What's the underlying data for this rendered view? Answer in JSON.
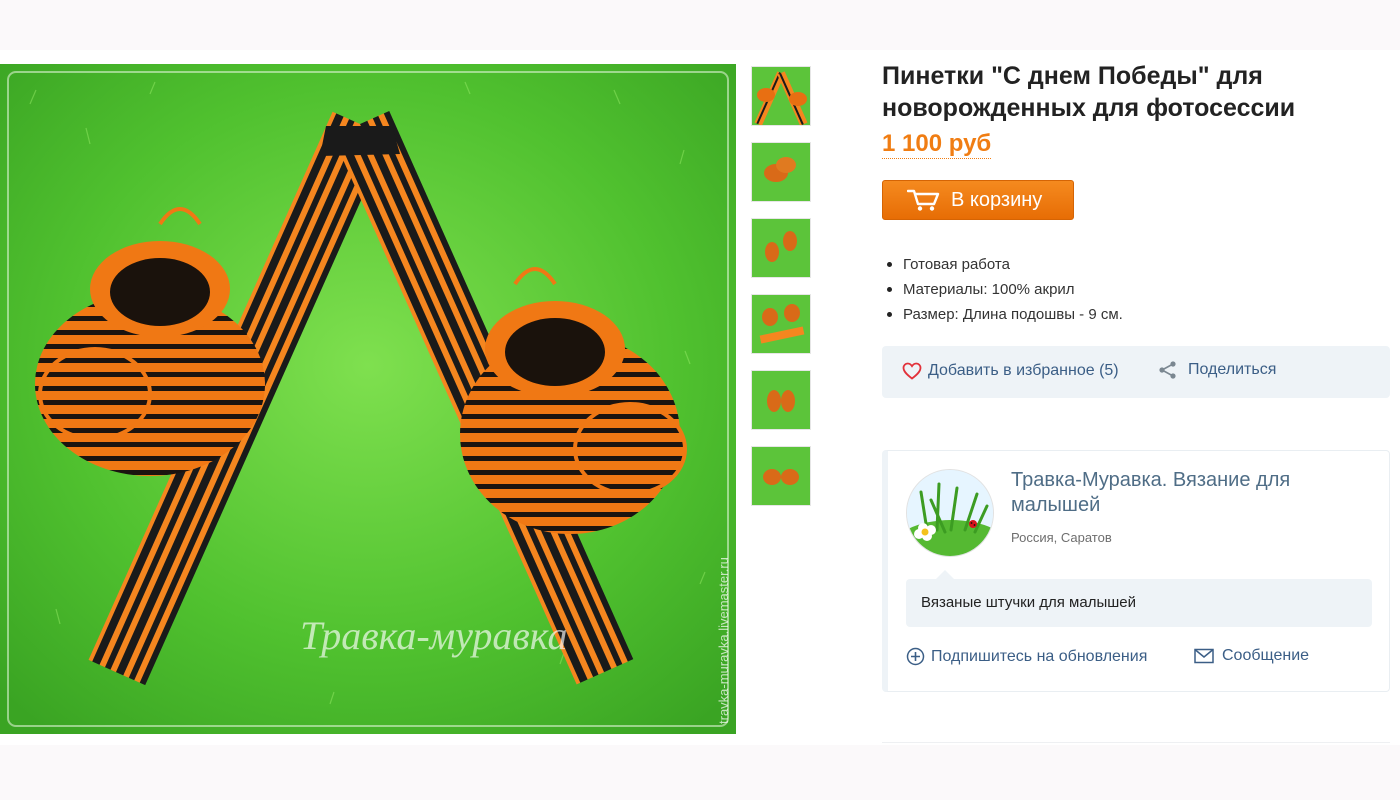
{
  "product": {
    "title": "Пинетки \"С днем Победы\" для новорожденных для фотосессии",
    "price": "1 100 руб",
    "cart_label": "В корзину",
    "watermark": "Травка-муравка",
    "side_watermark": "travka-muravka.livemaster.ru",
    "features": [
      "Готовая работа",
      "Материалы: 100% акрил",
      "Размер: Длина подошвы - 9 см."
    ]
  },
  "actions": {
    "favorite_label": "Добавить в избранное (5)",
    "share_label": "Поделиться"
  },
  "shop": {
    "name": "Травка-Муравка. Вязание для малышей",
    "location": "Россия, Саратов",
    "description": "Вязаные штучки для малышей",
    "subscribe_label": "Подпишитесь на обновления",
    "message_label": "Сообщение"
  },
  "colors": {
    "accent": "#f07d13",
    "link": "#3b5e86",
    "grass": "#49b82c",
    "ribbon_orange": "#f5861f",
    "ribbon_black": "#1a1a1a"
  },
  "icons": [
    "cart-icon",
    "heart-icon",
    "share-icon",
    "plus-circle-icon",
    "envelope-icon"
  ]
}
